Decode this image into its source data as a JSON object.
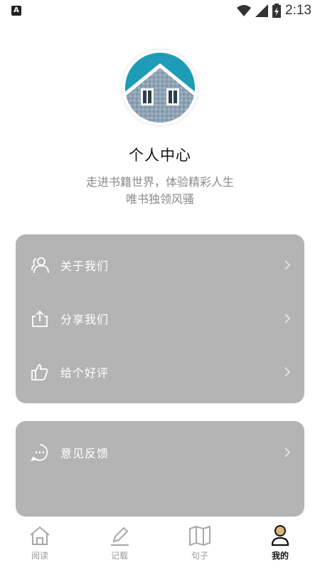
{
  "status_bar": {
    "time": "2:13",
    "left_icon_glyph": "A",
    "icons": [
      "wifi-icon",
      "signal-icon",
      "battery-charging-icon"
    ]
  },
  "profile": {
    "avatar": "house-window-avatar",
    "title": "个人中心",
    "subtitle_line1": "走进书籍世界，体验精彩人生",
    "subtitle_line2": "唯书独领风骚"
  },
  "menu_group1": [
    {
      "label": "关于我们",
      "icon": "users-icon"
    },
    {
      "label": "分享我们",
      "icon": "share-icon"
    },
    {
      "label": "给个好评",
      "icon": "thumbs-up-icon"
    }
  ],
  "menu_group2": [
    {
      "label": "意见反馈",
      "icon": "chat-bubble-icon"
    }
  ],
  "tabs": [
    {
      "label": "阅读",
      "icon": "home-icon",
      "active": false
    },
    {
      "label": "记载",
      "icon": "pencil-icon",
      "active": false
    },
    {
      "label": "句子",
      "icon": "book-icon",
      "active": false
    },
    {
      "label": "我的",
      "icon": "user-icon",
      "active": true
    }
  ],
  "colors": {
    "card_bg": "#b4b4b4",
    "tab_inactive": "#999999",
    "tab_active": "#111111",
    "subtitle": "#8a8a8a"
  }
}
